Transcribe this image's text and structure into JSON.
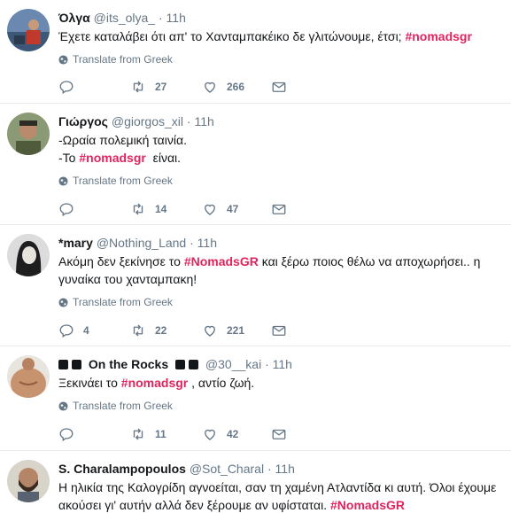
{
  "tweets": [
    {
      "name": "Όλγα",
      "handle": "@its_olya_",
      "dot": "·",
      "time": "11h",
      "text_parts": [
        "Έχετε καταλάβει ότι απ' το Χανταμπακέικο δε γλιτώνουμε, έτσι; ",
        "#nomadsgr"
      ],
      "translate": "Translate from Greek",
      "reply_count": "",
      "retweet_count": "27",
      "like_count": "266"
    },
    {
      "name": "Γιώργος",
      "handle": "@giorgos_xil",
      "dot": "·",
      "time": "11h",
      "line1": "-Ωραία πολεμική ταινία.",
      "line2_parts": [
        "-Το ",
        "#nomadsgr",
        "  είναι."
      ],
      "translate": "Translate from Greek",
      "reply_count": "",
      "retweet_count": "14",
      "like_count": "47"
    },
    {
      "name": "*mary",
      "handle": "@Nothing_Land",
      "dot": "·",
      "time": "11h",
      "text_parts": [
        "Ακόμη δεν ξεκίνησε το ",
        "#NomadsGR",
        " και ξέρω ποιος θέλω να αποχωρήσει.. η γυναίκα του χανταμπακη!"
      ],
      "translate": "Translate from Greek",
      "reply_count": "4",
      "retweet_count": "22",
      "like_count": "221"
    },
    {
      "name": "On the Rocks",
      "handle": "@30__kai",
      "dot": "·",
      "time": "11h",
      "text_parts": [
        "Ξεκινάει το ",
        "#nomadsgr",
        " , αντίο ζωή."
      ],
      "translate": "Translate from Greek",
      "reply_count": "",
      "retweet_count": "11",
      "like_count": "42"
    },
    {
      "name": "S. Charalampopoulos",
      "handle": "@Sot_Charal",
      "dot": "·",
      "time": "11h",
      "text_parts": [
        "Η ηλικία της Καλογρίδη αγνοείται, σαν τη χαμένη Ατλαντίδα κι αυτή. Όλοι έχουμε ακούσει γι' αυτήν αλλά δεν ξέρουμε αν υφίσταται. ",
        "#NomadsGR"
      ]
    }
  ],
  "icons": {
    "reply": "reply-icon",
    "retweet": "retweet-icon",
    "like": "heart-icon",
    "dm": "envelope-icon",
    "globe": "globe-icon"
  },
  "colors": {
    "hashtag": "#e0245e",
    "muted": "#657786",
    "divider": "#e6ecf0"
  }
}
